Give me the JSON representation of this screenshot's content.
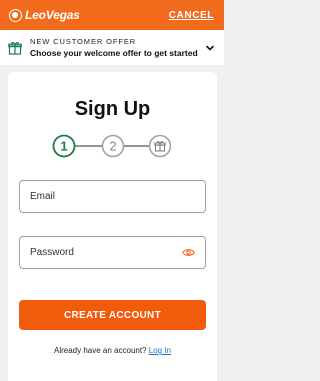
{
  "header": {
    "brand": "LeoVegas",
    "cancel_label": "CANCEL"
  },
  "offer_banner": {
    "title": "NEW CUSTOMER OFFER",
    "subtitle": "Choose your welcome offer to get started",
    "icon": "gift-icon",
    "toggle_icon": "chevron-down-icon"
  },
  "form": {
    "title": "Sign Up",
    "steps": [
      {
        "label": "1",
        "state": "active"
      },
      {
        "label": "2",
        "state": "inactive"
      },
      {
        "label": "",
        "icon": "gift-icon",
        "state": "inactive"
      }
    ],
    "email": {
      "placeholder": "Email",
      "value": ""
    },
    "password": {
      "placeholder": "Password",
      "value": "",
      "toggle_icon": "eye-icon"
    },
    "submit_label": "CREATE ACCOUNT",
    "login_prompt": "Already have an account?",
    "login_link": "Log In"
  },
  "colors": {
    "brand_orange": "#f26a1b",
    "cta_orange": "#f25a0c",
    "step_active_green": "#1f7a4a",
    "step_inactive_gray": "#9aa0a6",
    "link_blue": "#1a6fd1",
    "page_bg": "#eef0f2"
  }
}
